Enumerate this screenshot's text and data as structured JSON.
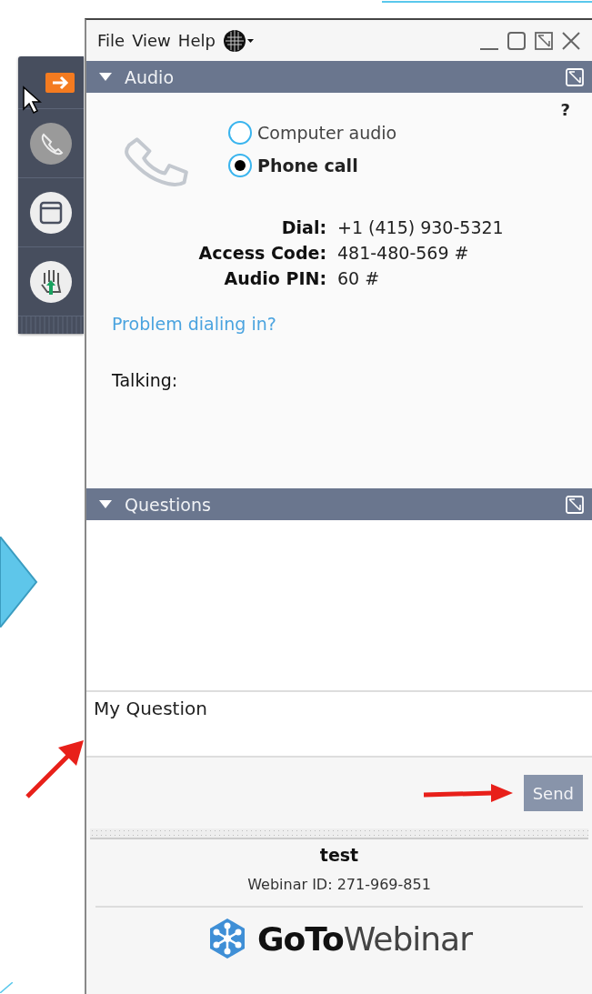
{
  "menu": [
    "File",
    "View",
    "Help"
  ],
  "audio": {
    "title": "Audio",
    "expanded": true,
    "help": "?",
    "options": [
      {
        "label": "Computer audio",
        "selected": false
      },
      {
        "label": "Phone call",
        "selected": true
      }
    ],
    "details": [
      {
        "label": "Dial:",
        "value": "+1 (415) 930-5321"
      },
      {
        "label": "Access Code:",
        "value": "481-480-569 #"
      },
      {
        "label": "Audio PIN:",
        "value": "60 #"
      }
    ],
    "link": "Problem dialing in?",
    "talking": "Talking:"
  },
  "questions": {
    "title": "Questions",
    "expanded": true,
    "input_value": "My Question",
    "send": "Send"
  },
  "footer": {
    "title": "test",
    "webinar_id": "Webinar ID: 271-969-851",
    "logo": "**GoTo**Webinar"
  }
}
